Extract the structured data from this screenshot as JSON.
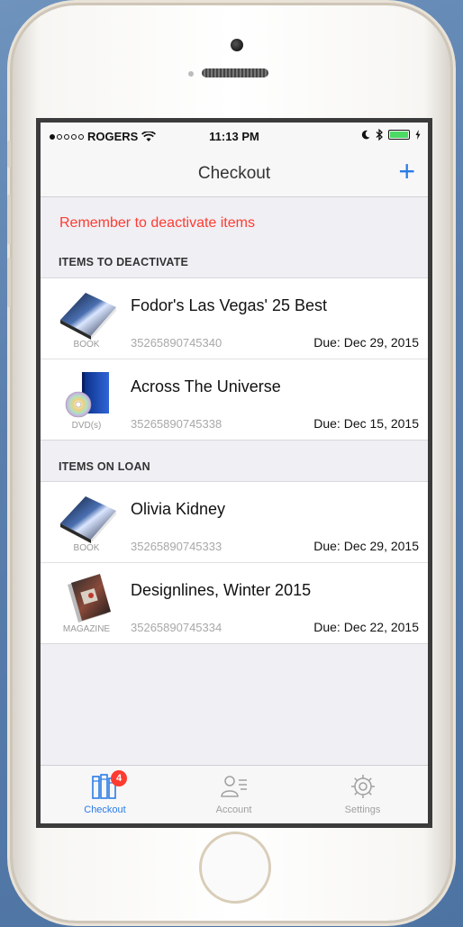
{
  "status_bar": {
    "carrier": "ROGERS",
    "time": "11:13 PM"
  },
  "nav": {
    "title": "Checkout",
    "add_label": "+"
  },
  "reminder": "Remember to deactivate items",
  "sections": [
    {
      "header": "ITEMS TO DEACTIVATE",
      "items": [
        {
          "title": "Fodor's Las Vegas' 25 Best",
          "type": "BOOK",
          "barcode": "35265890745340",
          "due": "Due: Dec 29, 2015",
          "icon": "book-icon"
        },
        {
          "title": "Across The Universe",
          "type": "DVD(s)",
          "barcode": "35265890745338",
          "due": "Due: Dec 15, 2015",
          "icon": "dvd-icon"
        }
      ]
    },
    {
      "header": "ITEMS ON LOAN",
      "items": [
        {
          "title": "Olivia Kidney",
          "type": "BOOK",
          "barcode": "35265890745333",
          "due": "Due: Dec 29, 2015",
          "icon": "book-icon"
        },
        {
          "title": "Designlines, Winter 2015",
          "type": "MAGAZINE",
          "barcode": "35265890745334",
          "due": "Due: Dec 22, 2015",
          "icon": "magazine-icon"
        }
      ]
    }
  ],
  "tabs": [
    {
      "label": "Checkout",
      "badge": "4",
      "icon": "books-icon",
      "active": true
    },
    {
      "label": "Account",
      "icon": "account-icon",
      "active": false
    },
    {
      "label": "Settings",
      "icon": "gear-icon",
      "active": false
    }
  ],
  "colors": {
    "accent": "#2c7be5",
    "warning": "#ff3b30",
    "badge": "#ff3b30",
    "inactive_tab": "#a0a0a0"
  }
}
